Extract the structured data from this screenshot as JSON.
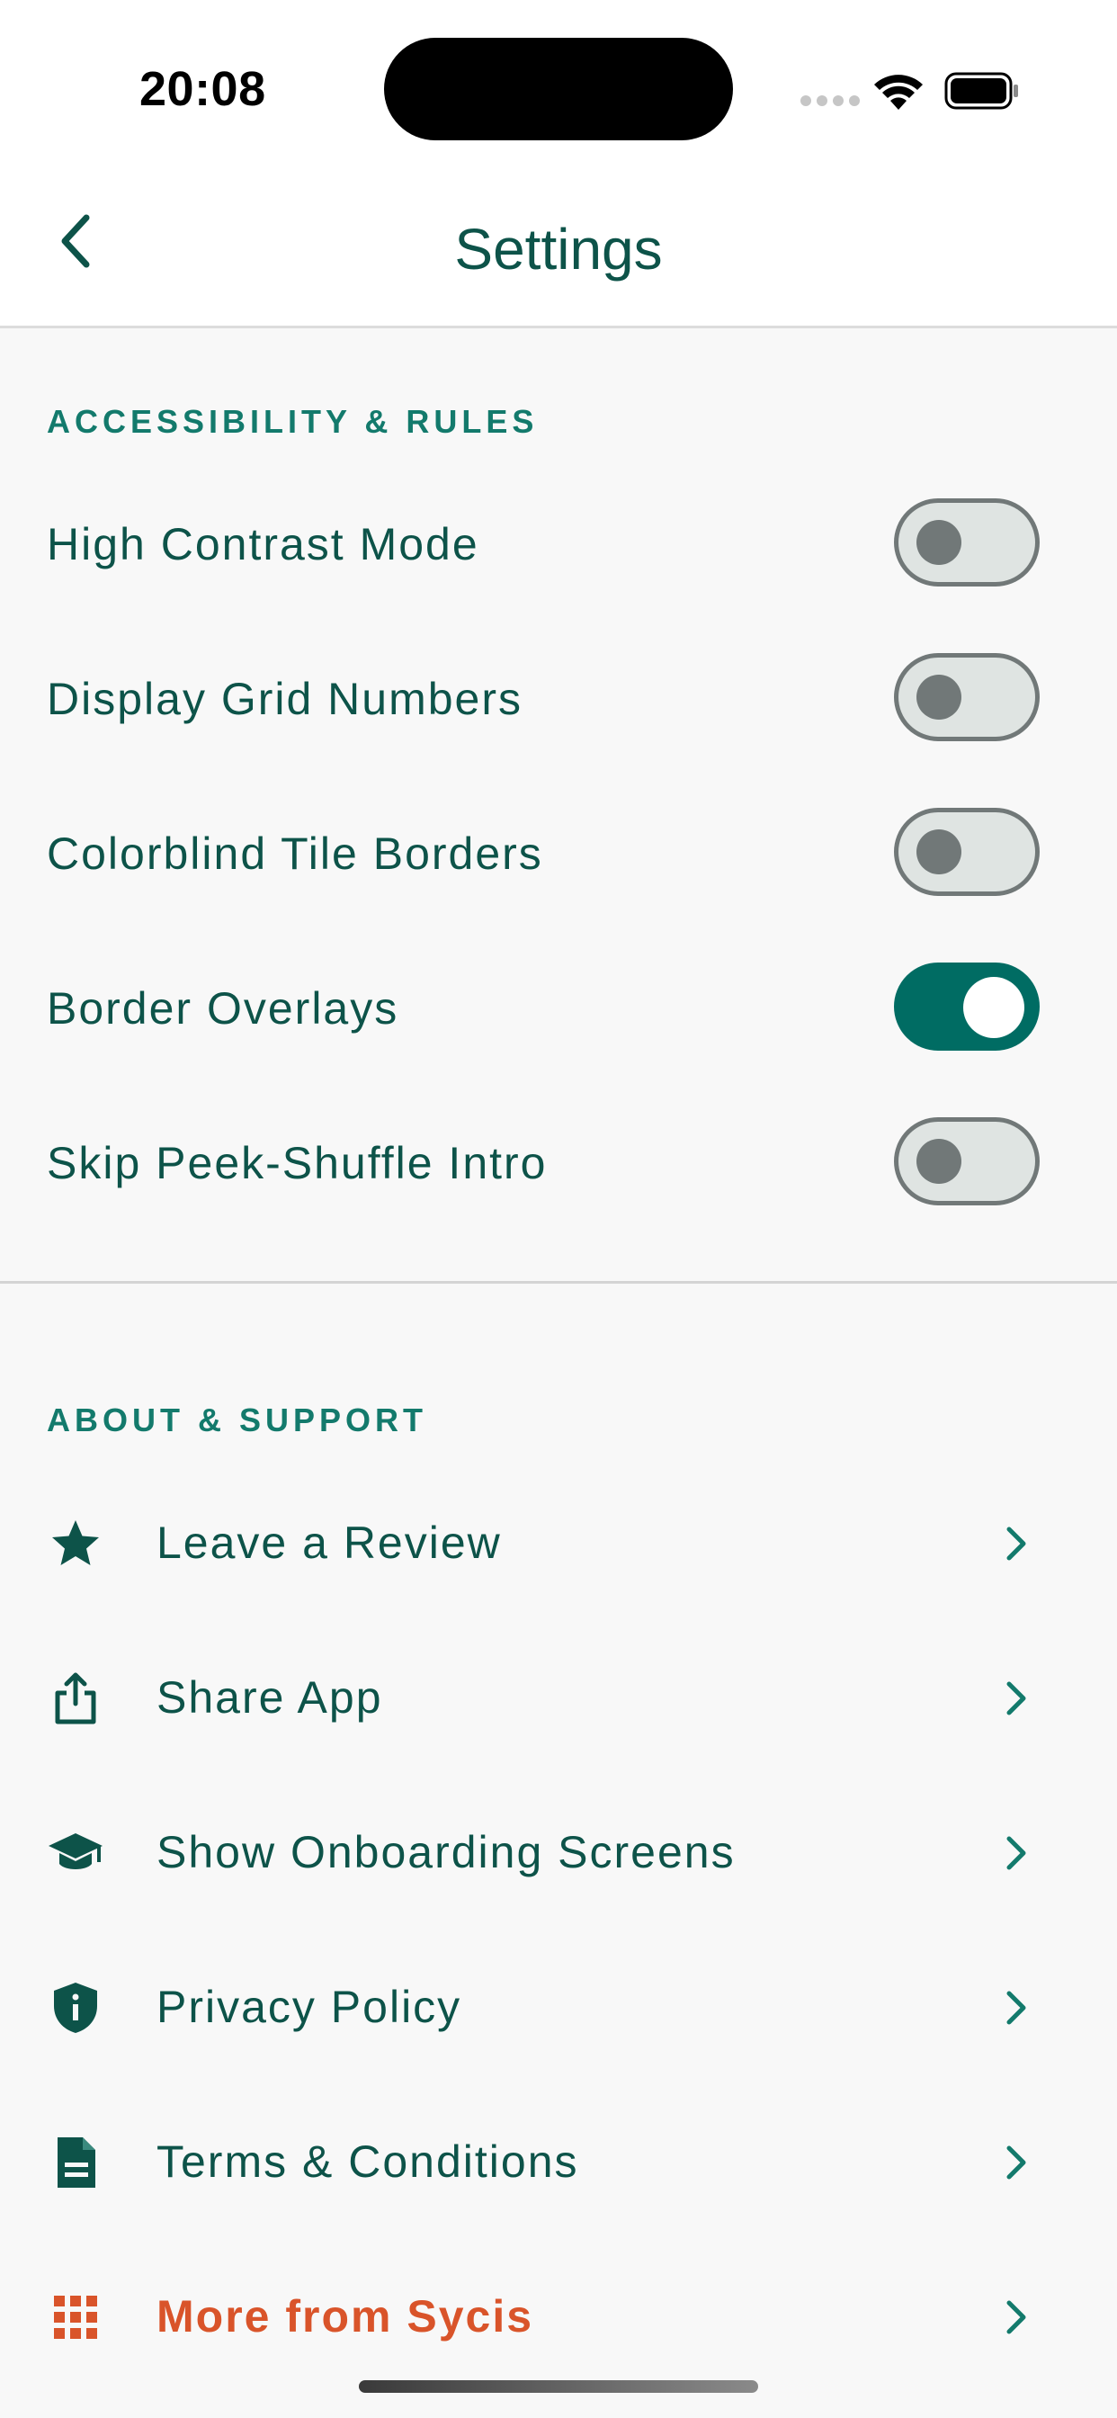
{
  "status_bar": {
    "time": "20:08"
  },
  "nav": {
    "title": "Settings"
  },
  "accessibility": {
    "header": "ACCESSIBILITY & RULES",
    "toggles": [
      {
        "label": "High Contrast Mode",
        "on": false
      },
      {
        "label": "Display Grid Numbers",
        "on": false
      },
      {
        "label": "Colorblind Tile Borders",
        "on": false
      },
      {
        "label": "Border Overlays",
        "on": true
      },
      {
        "label": "Skip Peek-Shuffle Intro",
        "on": false
      }
    ]
  },
  "about": {
    "header": "ABOUT & SUPPORT",
    "items": [
      {
        "label": "Leave a Review",
        "icon": "star-icon"
      },
      {
        "label": "Share App",
        "icon": "share-icon"
      },
      {
        "label": "Show Onboarding Screens",
        "icon": "graduation-cap-icon"
      },
      {
        "label": "Privacy Policy",
        "icon": "shield-info-icon"
      },
      {
        "label": "Terms & Conditions",
        "icon": "document-icon"
      },
      {
        "label": "More from Sycis",
        "icon": "apps-grid-icon"
      }
    ]
  },
  "colors": {
    "primary": "#0d5349",
    "accent_teal": "#137a6c",
    "toggle_on": "#006c63",
    "toggle_off_track": "#dfe4e2",
    "toggle_off_knob": "#717878",
    "highlight_orange": "#d9542a",
    "background": "#f8f8f8"
  }
}
